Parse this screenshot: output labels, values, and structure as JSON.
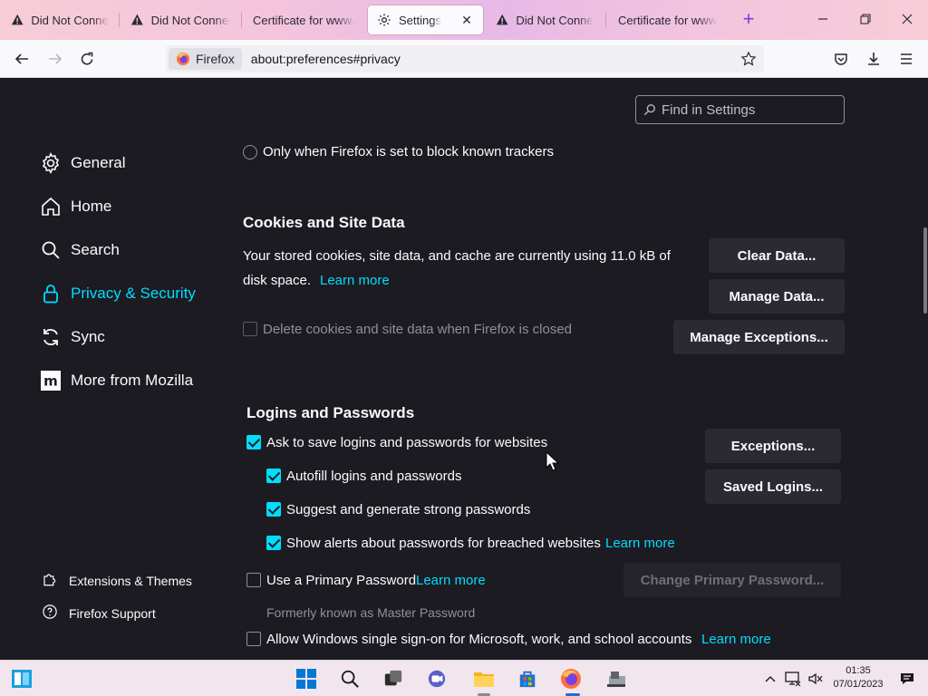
{
  "browser": {
    "tabs": [
      {
        "title": "Did Not Connect",
        "icon": "warning-icon"
      },
      {
        "title": "Did Not Connect",
        "icon": "warning-icon"
      },
      {
        "title": "Certificate for www.g",
        "icon": "none"
      },
      {
        "title": "Settings",
        "icon": "gear-icon",
        "selected": true,
        "close": "✕"
      },
      {
        "title": "Did Not Connect",
        "icon": "warning-icon"
      },
      {
        "title": "Certificate for www.y",
        "icon": "none"
      }
    ],
    "new_tab": "+",
    "identity_label": "Firefox",
    "url": "about:preferences#privacy",
    "accent_color": "#00ddff"
  },
  "search": {
    "placeholder": "Find in Settings"
  },
  "sidebar": {
    "items": [
      {
        "label": "General",
        "icon": "gear-icon"
      },
      {
        "label": "Home",
        "icon": "home-icon"
      },
      {
        "label": "Search",
        "icon": "search-icon"
      },
      {
        "label": "Privacy & Security",
        "icon": "lock-icon",
        "active": true
      },
      {
        "label": "Sync",
        "icon": "sync-icon"
      },
      {
        "label": "More from Mozilla",
        "icon": "mozilla-icon"
      }
    ],
    "footer": [
      {
        "label": "Extensions & Themes",
        "icon": "puzzle-icon"
      },
      {
        "label": "Firefox Support",
        "icon": "help-icon"
      }
    ]
  },
  "tracking": {
    "radio_label": "Only when Firefox is set to block known trackers"
  },
  "cookies": {
    "heading": "Cookies and Site Data",
    "usage_line1": "Your stored cookies, site data, and cache are currently using 11.0 kB of",
    "usage_line2": "disk space.",
    "learn_more": "Learn more",
    "clear_data": "Clear Data...",
    "manage_data": "Manage Data...",
    "manage_exceptions": "Manage Exceptions...",
    "delete_on_close": "Delete cookies and site data when Firefox is closed"
  },
  "logins": {
    "heading": "Logins and Passwords",
    "ask_to_save": "Ask to save logins and passwords for websites",
    "autofill": "Autofill logins and passwords",
    "suggest": "Suggest and generate strong passwords",
    "breach_alerts": "Show alerts about passwords for breached websites",
    "breach_learn_more": "Learn more",
    "primary_password": "Use a Primary Password",
    "primary_learn_more": "Learn more",
    "formerly": "Formerly known as Master Password",
    "windows_sso": "Allow Windows single sign-on for Microsoft, work, and school accounts",
    "sso_learn_more": "Learn more",
    "exceptions": "Exceptions...",
    "saved_logins": "Saved Logins...",
    "change_primary": "Change Primary Password..."
  },
  "taskbar": {
    "time": "01:35",
    "date": "07/01/2023"
  }
}
